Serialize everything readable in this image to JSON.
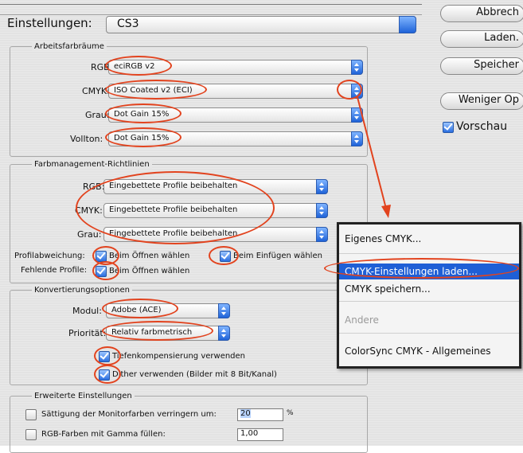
{
  "header": {
    "label": "Einstellungen:",
    "value": "CS3"
  },
  "side_buttons": {
    "abbrechen": "Abbrech",
    "laden": "Laden.",
    "speichern": "Speicher",
    "weniger": "Weniger Op",
    "vorschau": "Vorschau",
    "vorschau_checked": true
  },
  "arbeitsfarbraeume": {
    "title": "Arbeitsfarbräume",
    "rgb_label": "RGB:",
    "rgb_value": "eciRGB v2",
    "cmyk_label": "CMYK:",
    "cmyk_value": "ISO Coated v2 (ECI)",
    "grau_label": "Grau:",
    "grau_value": "Dot Gain 15%",
    "vollton_label": "Vollton:",
    "vollton_value": "Dot Gain 15%"
  },
  "farbmanagement": {
    "title": "Farbmanagement-Richtlinien",
    "rgb_label": "RGB:",
    "rgb_value": "Eingebettete Profile beibehalten",
    "cmyk_label": "CMYK:",
    "cmyk_value": "Eingebettete Profile beibehalten",
    "grau_label": "Grau:",
    "grau_value": "Eingebettete Profile beibehalten",
    "profilabweichung_label": "Profilabweichung:",
    "beim_oeffnen": "Beim Öffnen wählen",
    "beim_einfuegen": "Beim Einfügen wählen",
    "fehlende_label": "Fehlende Profile:",
    "fehlende_oeffnen": "Beim Öffnen wählen"
  },
  "konvertierung": {
    "title": "Konvertierungsoptionen",
    "modul_label": "Modul:",
    "modul_value": "Adobe (ACE)",
    "prioritaet_label": "Priorität:",
    "prioritaet_value": "Relativ farbmetrisch",
    "tiefen": "Tiefenkompensierung verwenden",
    "dither": "Dither verwenden (Bilder mit 8 Bit/Kanal)"
  },
  "erweitert": {
    "title": "Erweiterte Einstellungen",
    "saettigung": "Sättigung der Monitorfarben verringern um:",
    "saettigung_value": "20",
    "saettigung_unit": "%",
    "gamma": "RGB-Farben mit Gamma füllen:",
    "gamma_value": "1,00"
  },
  "menu": {
    "items": [
      "Eigenes CMYK...",
      "CMYK-Einstellungen laden...",
      "CMYK speichern...",
      "Andere",
      "ColorSync CMYK - Allgemeines"
    ],
    "selected_index": 1
  },
  "colors": {
    "annotation": "#e2431e",
    "selection": "#1f5fd6",
    "accent_blue": "#2a6ee0"
  }
}
